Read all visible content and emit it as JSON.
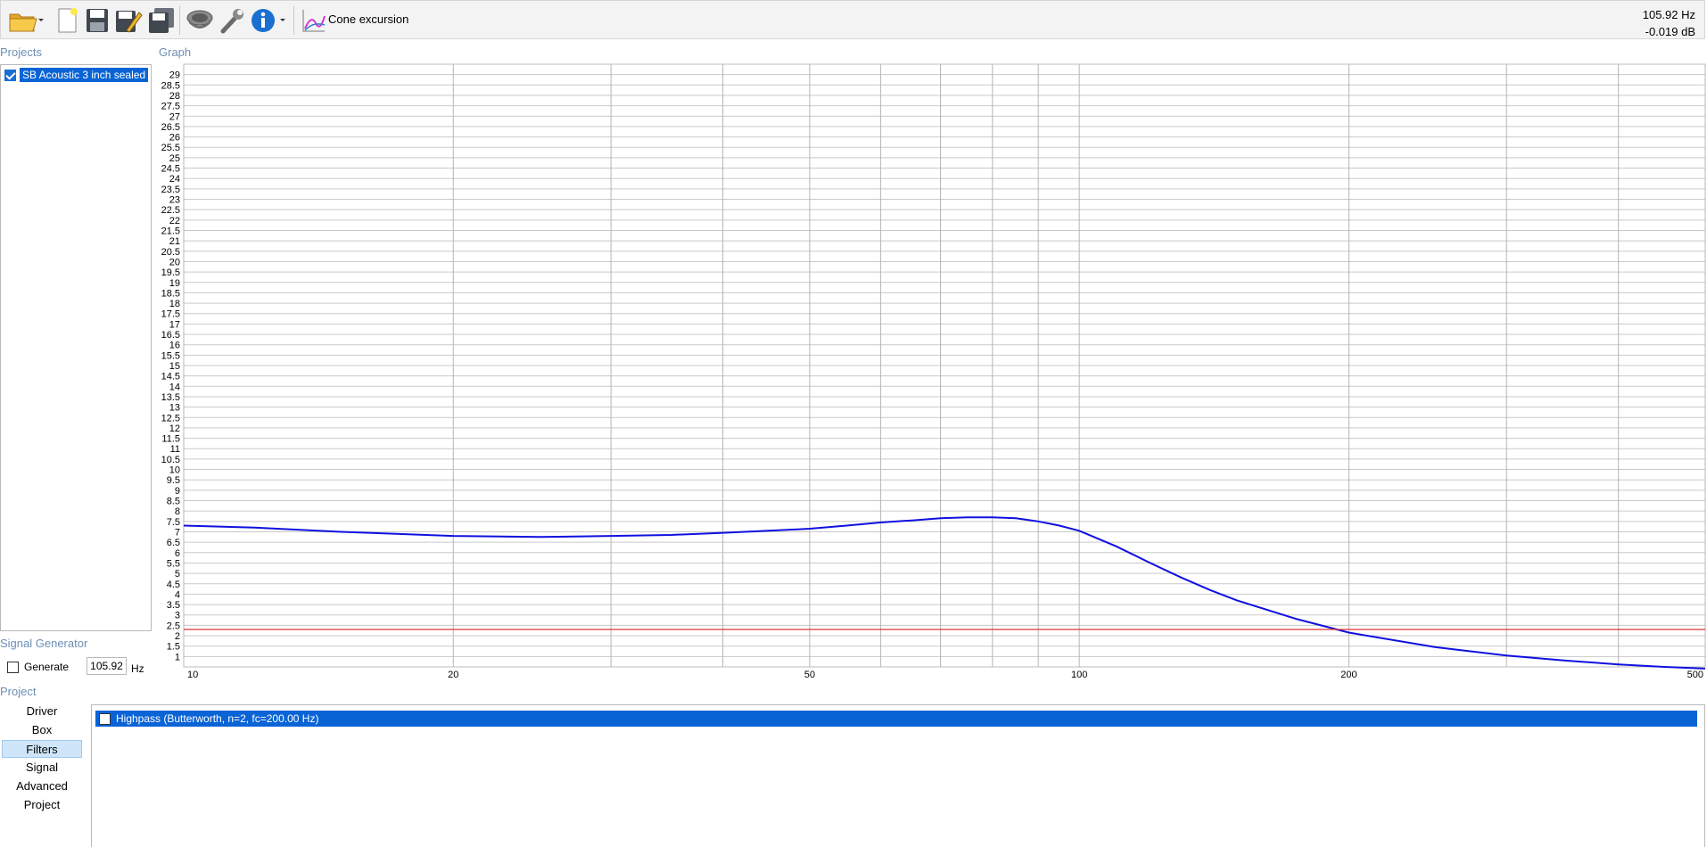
{
  "toolbar": {
    "icons": [
      "open-folder-icon",
      "new-file-icon",
      "save-icon",
      "save-as-icon",
      "save-all-icon",
      "speaker-icon",
      "wrench-icon",
      "info-icon",
      "chart-icon"
    ],
    "graph_select_label": "Cone excursion"
  },
  "readout": {
    "frequency": "105.92 Hz",
    "level": "-0.019 dB"
  },
  "projects": {
    "title": "Projects",
    "items": [
      {
        "label": "SB Acoustic 3 inch sealed",
        "checked": true
      }
    ]
  },
  "graph": {
    "title": "Graph"
  },
  "signal_generator": {
    "title": "Signal Generator",
    "generate_label": "Generate",
    "frequency_value": "105.92",
    "unit": "Hz"
  },
  "project_panel": {
    "title": "Project",
    "nav": [
      "Driver",
      "Box",
      "Filters",
      "Signal",
      "Advanced",
      "Project"
    ],
    "active": "Filters",
    "filters": [
      {
        "label": "Highpass (Butterworth, n=2, fc=200.00 Hz)",
        "checked": false
      }
    ]
  },
  "chart_data": {
    "type": "line",
    "xscale": "log",
    "xlim": [
      10,
      500
    ],
    "ylim": [
      0.5,
      29.5
    ],
    "x_ticks": [
      10,
      20,
      50,
      100,
      200,
      500
    ],
    "y_ticks": [
      "1",
      "1.5",
      "2",
      "2.5",
      "3",
      "3.5",
      "4",
      "4.5",
      "5",
      "5.5",
      "6",
      "6.5",
      "7",
      "7.5",
      "8",
      "8.5",
      "9",
      "9.5",
      "10",
      "10.5",
      "11",
      "11.5",
      "12",
      "12.5",
      "13",
      "13.5",
      "14",
      "14.5",
      "15",
      "15.5",
      "16",
      "16.5",
      "17",
      "17.5",
      "18",
      "18.5",
      "19",
      "19.5",
      "20",
      "20.5",
      "21",
      "21.5",
      "22",
      "22.5",
      "23",
      "23.5",
      "24",
      "24.5",
      "25",
      "25.5",
      "26",
      "26.5",
      "27",
      "27.5",
      "28",
      "28.5",
      "29"
    ],
    "series": [
      {
        "color": "#1010e0",
        "x": [
          10,
          12,
          15,
          20,
          25,
          30,
          35,
          40,
          45,
          50,
          55,
          60,
          65,
          70,
          75,
          80,
          85,
          90,
          95,
          100,
          110,
          120,
          130,
          140,
          150,
          175,
          200,
          250,
          300,
          350,
          400,
          450,
          500
        ],
        "y": [
          7.3,
          7.2,
          7.0,
          6.8,
          6.75,
          6.8,
          6.85,
          6.95,
          7.05,
          7.15,
          7.3,
          7.45,
          7.55,
          7.65,
          7.7,
          7.7,
          7.65,
          7.5,
          7.3,
          7.05,
          6.3,
          5.5,
          4.8,
          4.2,
          3.7,
          2.8,
          2.15,
          1.45,
          1.05,
          0.8,
          0.62,
          0.5,
          0.42
        ]
      },
      {
        "color": "#e03030",
        "x": [
          10,
          500
        ],
        "y": [
          2.3,
          2.3
        ]
      }
    ]
  }
}
